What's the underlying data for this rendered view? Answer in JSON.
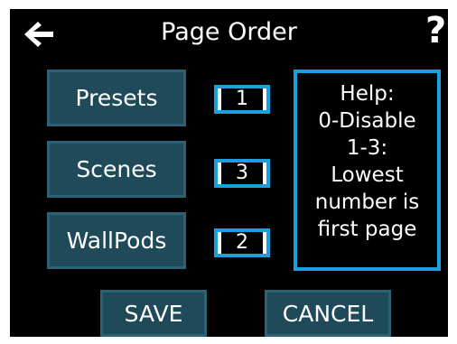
{
  "header": {
    "title": "Page Order",
    "back_icon": "arrow-left-icon",
    "help_icon_glyph": "?"
  },
  "pages": [
    {
      "label": "Presets",
      "order": "1"
    },
    {
      "label": "Scenes",
      "order": "3"
    },
    {
      "label": "WallPods",
      "order": "2"
    }
  ],
  "help": {
    "lines": [
      "Help:",
      "0-Disable",
      "1-3:",
      "Lowest",
      "number is",
      "first page"
    ]
  },
  "actions": {
    "save_label": "SAVE",
    "cancel_label": "CANCEL"
  },
  "colors": {
    "background": "#000000",
    "button_fill": "#1f4a5a",
    "button_border": "#2c6374",
    "accent_border": "#1aa0dd",
    "text": "#ffffff"
  }
}
